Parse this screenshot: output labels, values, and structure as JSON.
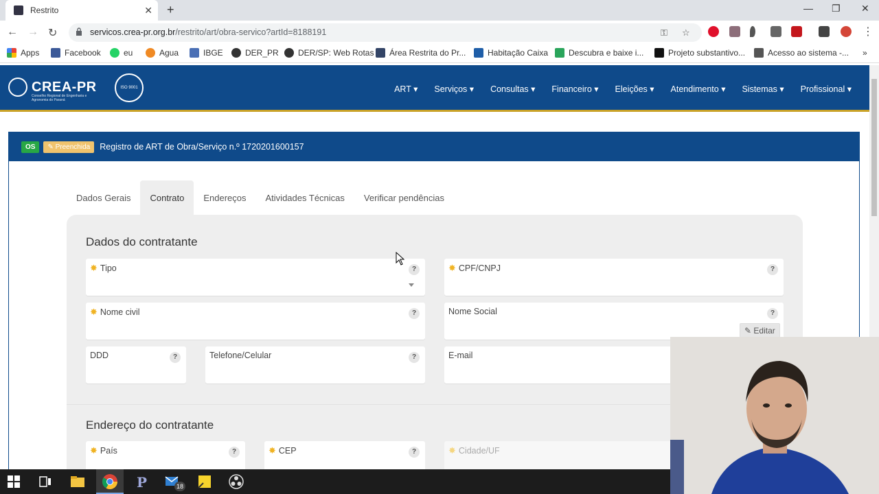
{
  "browser": {
    "tab_title": "Restrito",
    "url_host": "servicos.crea-pr.org.br",
    "url_path": "/restrito/art/obra-servico?artId=8188191",
    "bookmarks": [
      {
        "label": "Apps",
        "icon": "apps-grid-icon",
        "color": "#e94235"
      },
      {
        "label": "Facebook",
        "icon": "facebook-icon",
        "color": "#3b5998"
      },
      {
        "label": "eu",
        "icon": "whatsapp-icon",
        "color": "#25d366"
      },
      {
        "label": "Agua",
        "icon": "water-icon",
        "color": "#f08a24"
      },
      {
        "label": "IBGE",
        "icon": "ibge-icon",
        "color": "#4a6fb5"
      },
      {
        "label": "DER_PR",
        "icon": "globe-icon",
        "color": "#333333"
      },
      {
        "label": "DER/SP: Web Rotas",
        "icon": "globe-icon",
        "color": "#333333"
      },
      {
        "label": "Área Restrita do Pr...",
        "icon": "crea-icon",
        "color": "#334466"
      },
      {
        "label": "Habitação Caixa",
        "icon": "caixa-icon",
        "color": "#1f5ea8"
      },
      {
        "label": "Descubra e baixe i...",
        "icon": "px-icon",
        "color": "#2aa55b"
      },
      {
        "label": "Projeto substantivo...",
        "icon": "dots-icon",
        "color": "#111111"
      },
      {
        "label": "Acesso ao sistema -...",
        "icon": "system-icon",
        "color": "#555555"
      }
    ],
    "more_bookmarks": "»"
  },
  "site": {
    "logo_text": "CREA-PR",
    "logo_subtitle": "Conselho Regional de Engenharia e Agronomia do Paraná",
    "iso_text": "ISO 9001",
    "nav": [
      "ART",
      "Serviços",
      "Consultas",
      "Financeiro",
      "Eleições",
      "Atendimento",
      "Sistemas",
      "Profissional"
    ]
  },
  "panel": {
    "badge_type": "OS",
    "badge_status": "Preenchida",
    "title": "Registro de ART de Obra/Serviço n.º 1720201600157"
  },
  "tabs": [
    {
      "label": "Dados Gerais",
      "active": false
    },
    {
      "label": "Contrato",
      "active": true
    },
    {
      "label": "Endereços",
      "active": false
    },
    {
      "label": "Atividades Técnicas",
      "active": false
    },
    {
      "label": "Verificar pendências",
      "active": false
    }
  ],
  "contratante": {
    "title": "Dados do contratante",
    "tipo": "Tipo",
    "cpf": "CPF/CNPJ",
    "nome_civil": "Nome civil",
    "nome_social": "Nome Social",
    "editar": "Editar",
    "ddd": "DDD",
    "telefone": "Telefone/Celular",
    "email": "E-mail",
    "help": "?"
  },
  "endereco": {
    "title": "Endereço do contratante",
    "pais": "País",
    "cep": "CEP",
    "cidade": "Cidade/UF"
  },
  "taskbar": {
    "mail_count": "18"
  }
}
